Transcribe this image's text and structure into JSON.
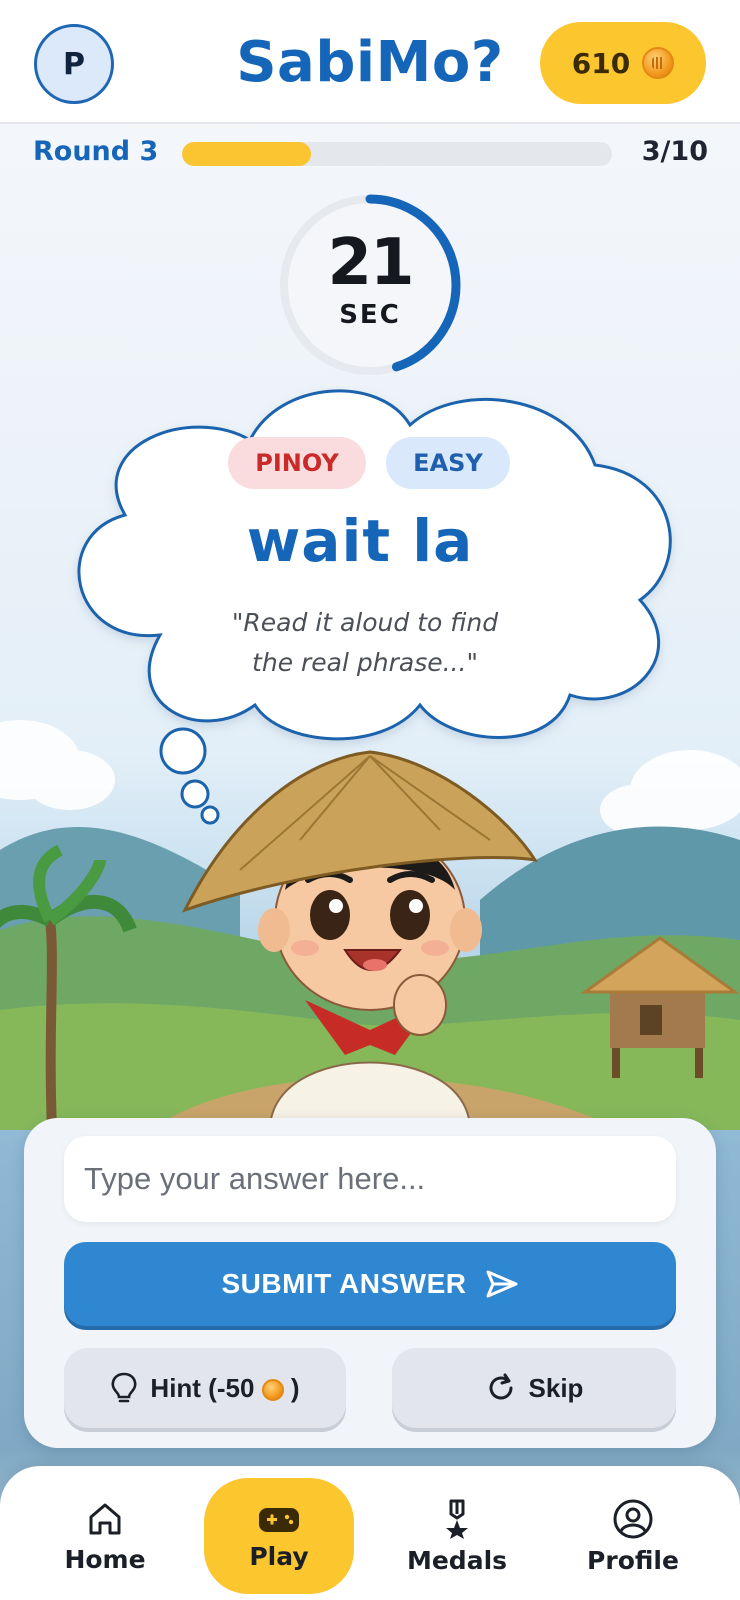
{
  "header": {
    "avatar_initial": "P",
    "app_title": "SabiMo?",
    "coin_balance": "610"
  },
  "progress": {
    "round_label": "Round 3",
    "count_label": "3/10",
    "fraction": 0.3
  },
  "timer": {
    "seconds": "21",
    "unit": "SEC",
    "remaining_fraction": 0.45,
    "ring_color": "#1565b8"
  },
  "question": {
    "category_tag": "PINOY",
    "difficulty_tag": "EASY",
    "phrase": "wait la",
    "instruction": "\"Read it aloud to find the real phrase...\""
  },
  "answer": {
    "placeholder": "Type your answer here...",
    "submit_label": "SUBMIT ANSWER",
    "hint_label_prefix": "Hint (-50",
    "hint_label_suffix": ")",
    "skip_label": "Skip"
  },
  "nav": {
    "items": [
      {
        "label": "Home",
        "icon": "home-icon"
      },
      {
        "label": "Play",
        "icon": "gamepad-icon",
        "active": true
      },
      {
        "label": "Medals",
        "icon": "medal-icon"
      },
      {
        "label": "Profile",
        "icon": "profile-icon"
      }
    ]
  },
  "colors": {
    "brand_blue": "#1565b8",
    "accent_yellow": "#fcc62f",
    "submit_blue": "#2f86d1",
    "tag_red": "#c92a2a"
  }
}
